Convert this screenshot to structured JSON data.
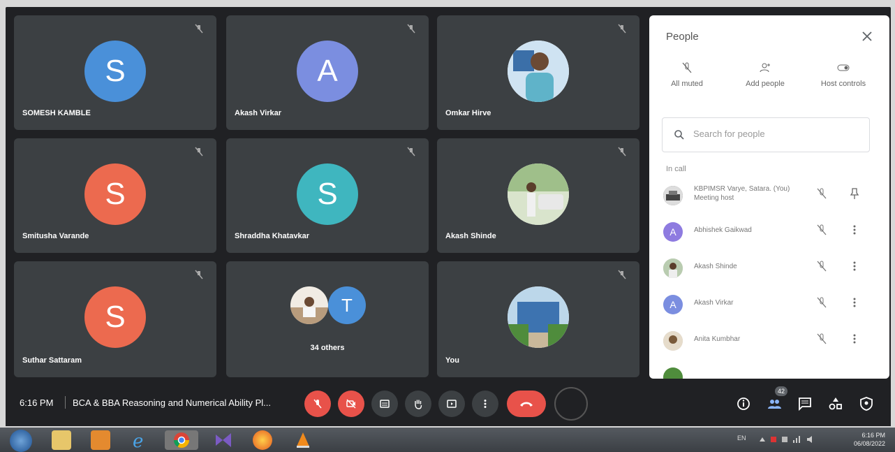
{
  "tiles": [
    {
      "name": "SOMESH KAMBLE",
      "initial": "S",
      "color": "#4a90d9"
    },
    {
      "name": "Akash Virkar",
      "initial": "A",
      "color": "#7b8ee0"
    },
    {
      "name": "Omkar Hirve"
    },
    {
      "name": "Smitusha Varande",
      "initial": "S",
      "color": "#ec6a4f"
    },
    {
      "name": "Shraddha Khatavkar",
      "initial": "S",
      "color": "#3fb6bf"
    },
    {
      "name": "Akash Shinde"
    },
    {
      "name": "Suthar Sattaram",
      "initial": "S",
      "color": "#ec6a4f"
    },
    {
      "others_label": "34 others",
      "initial": "T",
      "color": "#4a90d9"
    },
    {
      "name": "You"
    }
  ],
  "people_panel": {
    "title": "People",
    "actions": [
      "All muted",
      "Add people",
      "Host controls"
    ],
    "search_placeholder": "Search for people",
    "in_call_label": "In call",
    "participants": [
      {
        "name": "KBPIMSR Varye, Satara. (You)",
        "sub": "Meeting host"
      },
      {
        "name": "Abhishek Gaikwad",
        "initial": "A",
        "color": "#8e7be0"
      },
      {
        "name": "Akash Shinde"
      },
      {
        "name": "Akash Virkar",
        "initial": "A",
        "color": "#7b8ee0"
      },
      {
        "name": "Anita Kumbhar"
      }
    ]
  },
  "bottom_bar": {
    "time": "6:16 PM",
    "meeting_title": "BCA & BBA Reasoning and Numerical Ability Pl...",
    "participant_count": "42"
  },
  "taskbar": {
    "lang": "EN",
    "clock_time": "6:16 PM",
    "clock_date": "06/08/2022"
  }
}
